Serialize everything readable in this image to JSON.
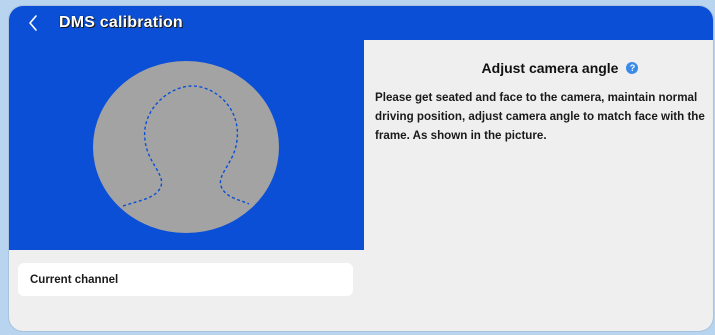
{
  "header": {
    "title": "DMS calibration",
    "back_icon": "chevron-left-icon"
  },
  "preview": {
    "background_color": "#0a4fd6",
    "face_oval_color": "#a3a3a3",
    "guide_color": "#0a4fd6"
  },
  "channel": {
    "label": "Current channel"
  },
  "instructions": {
    "heading": "Adjust camera angle",
    "help_icon": "question-icon",
    "help_glyph": "?",
    "text": "Please get seated and face to the camera, maintain normal driving position, adjust camera angle to match face with the frame. As shown in the picture."
  },
  "colors": {
    "accent": "#0a4fd6",
    "background": "#efefef"
  }
}
